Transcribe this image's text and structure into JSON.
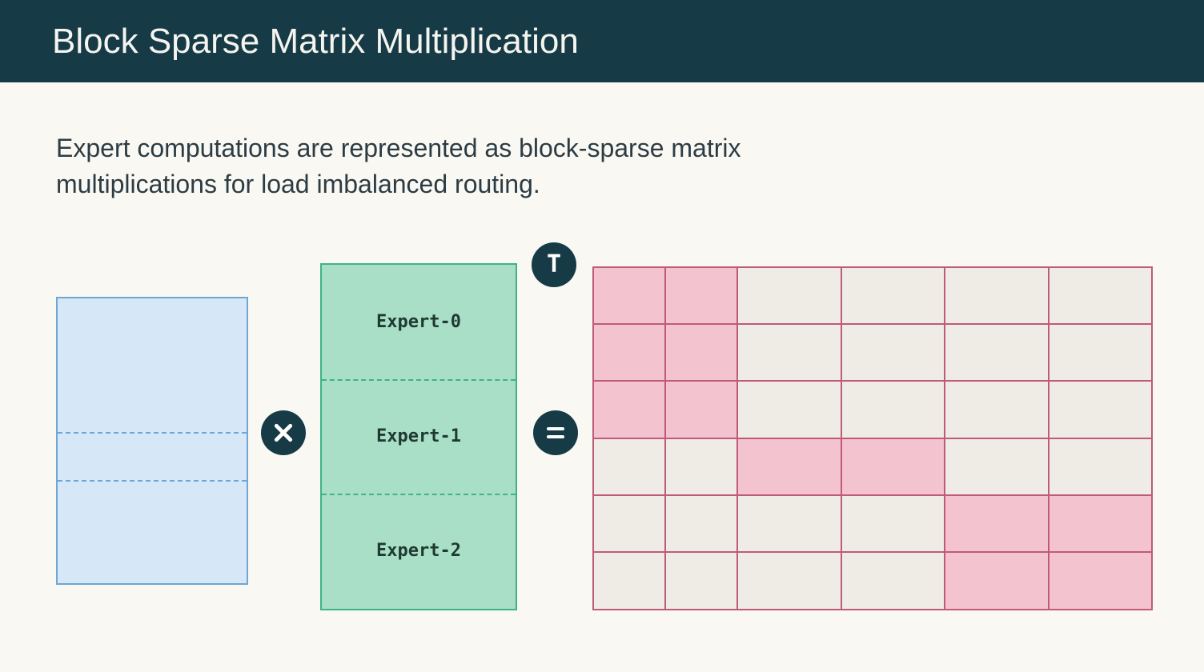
{
  "header": {
    "title": "Block Sparse Matrix Multiplication"
  },
  "subtitle": "Expert computations are represented as block-sparse matrix multiplications for load imbalanced routing.",
  "operators": {
    "multiply": "×",
    "equals": "=",
    "transpose": "T"
  },
  "blue_matrix": {
    "row_splits_pct": [
      47,
      64
    ]
  },
  "green_matrix": {
    "experts": [
      "Expert-0",
      "Expert-1",
      "Expert-2"
    ],
    "row_splits_pct": [
      33.3,
      66.6
    ]
  },
  "result_grid": {
    "rows": 6,
    "cols": 6,
    "filled_cells": [
      [
        0,
        0
      ],
      [
        0,
        1
      ],
      [
        1,
        0
      ],
      [
        1,
        1
      ],
      [
        2,
        0
      ],
      [
        2,
        1
      ],
      [
        3,
        2
      ],
      [
        3,
        3
      ],
      [
        4,
        4
      ],
      [
        4,
        5
      ],
      [
        5,
        4
      ],
      [
        5,
        5
      ]
    ]
  },
  "colors": {
    "header_bg": "#163b47",
    "page_bg": "#faf8f3",
    "blue_fill": "#d6e8f8",
    "blue_border": "#6fa6d6",
    "green_fill": "#aadfc7",
    "green_border": "#3cb38a",
    "pink_fill": "#f3c3cf",
    "pink_border": "#c05a7a",
    "grey_fill": "#efece6"
  }
}
